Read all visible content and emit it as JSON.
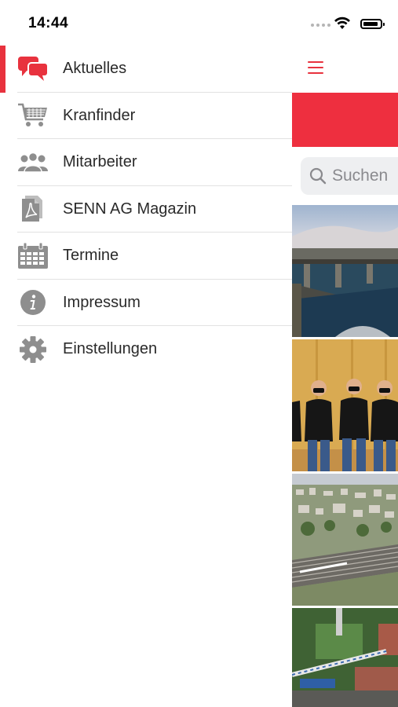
{
  "status_bar": {
    "time": "14:44"
  },
  "menu": {
    "items": [
      {
        "label": "Aktuelles",
        "icon": "chat-bubbles-icon",
        "active": true
      },
      {
        "label": "Kranfinder",
        "icon": "shopping-cart-icon",
        "active": false
      },
      {
        "label": "Mitarbeiter",
        "icon": "people-icon",
        "active": false
      },
      {
        "label": "SENN AG Magazin",
        "icon": "pdf-document-icon",
        "active": false
      },
      {
        "label": "Termine",
        "icon": "calendar-icon",
        "active": false
      },
      {
        "label": "Impressum",
        "icon": "info-icon",
        "active": false
      },
      {
        "label": "Einstellungen",
        "icon": "gear-icon",
        "active": false
      }
    ]
  },
  "content": {
    "search_placeholder": "Suchen",
    "menu_button_icon": "hamburger-menu-icon"
  },
  "colors": {
    "accent": "#e8323e",
    "icon_gray": "#8e8e8e",
    "separator": "#e2e2e2"
  }
}
